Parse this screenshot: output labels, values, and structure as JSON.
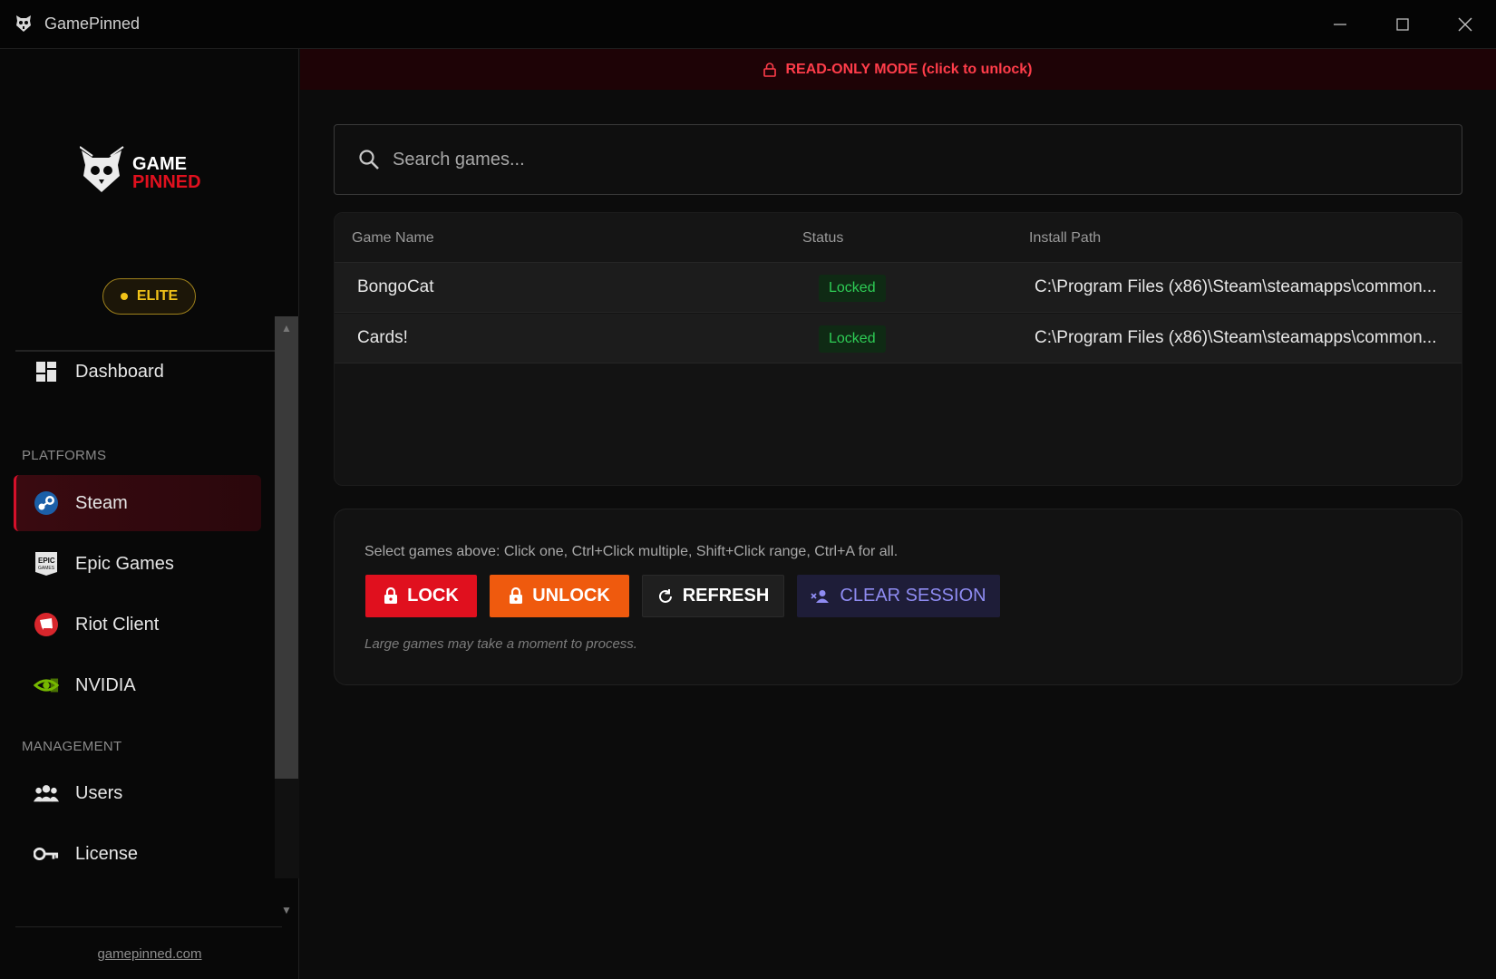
{
  "window": {
    "title": "GamePinned"
  },
  "logo": {
    "line1": "GAME",
    "line2": "PINNED"
  },
  "badge": {
    "label": "ELITE"
  },
  "sidebar": {
    "dashboard": "Dashboard",
    "platforms_label": "PLATFORMS",
    "platforms": [
      {
        "label": "Steam",
        "icon": "steam-icon",
        "active": true
      },
      {
        "label": "Epic Games",
        "icon": "epic-games-icon",
        "active": false
      },
      {
        "label": "Riot Client",
        "icon": "riot-client-icon",
        "active": false
      },
      {
        "label": "NVIDIA",
        "icon": "nvidia-icon",
        "active": false
      }
    ],
    "management_label": "MANAGEMENT",
    "management": [
      {
        "label": "Users",
        "icon": "users-icon"
      },
      {
        "label": "License",
        "icon": "key-icon"
      }
    ],
    "footer_link": "gamepinned.com"
  },
  "banner": {
    "text": "READ-ONLY MODE (click to unlock)"
  },
  "search": {
    "placeholder": "Search games..."
  },
  "table": {
    "columns": [
      "Game Name",
      "Status",
      "Install Path"
    ],
    "rows": [
      {
        "name": "BongoCat",
        "status": "Locked",
        "path": "C:\\Program Files (x86)\\Steam\\steamapps\\common..."
      },
      {
        "name": "Cards!",
        "status": "Locked",
        "path": "C:\\Program Files (x86)\\Steam\\steamapps\\common..."
      }
    ]
  },
  "actions": {
    "hint": "Select games above: Click one, Ctrl+Click multiple, Shift+Click range, Ctrl+A for all.",
    "lock": "LOCK",
    "unlock": "UNLOCK",
    "refresh": "REFRESH",
    "clear_session": "CLEAR SESSION",
    "note": "Large games may take a moment to process."
  },
  "colors": {
    "accent_red": "#e0101e",
    "accent_orange": "#ef5a0e",
    "status_green": "#2ecc55",
    "elite_gold": "#f2c318",
    "banner_red": "#ff3d4a"
  }
}
